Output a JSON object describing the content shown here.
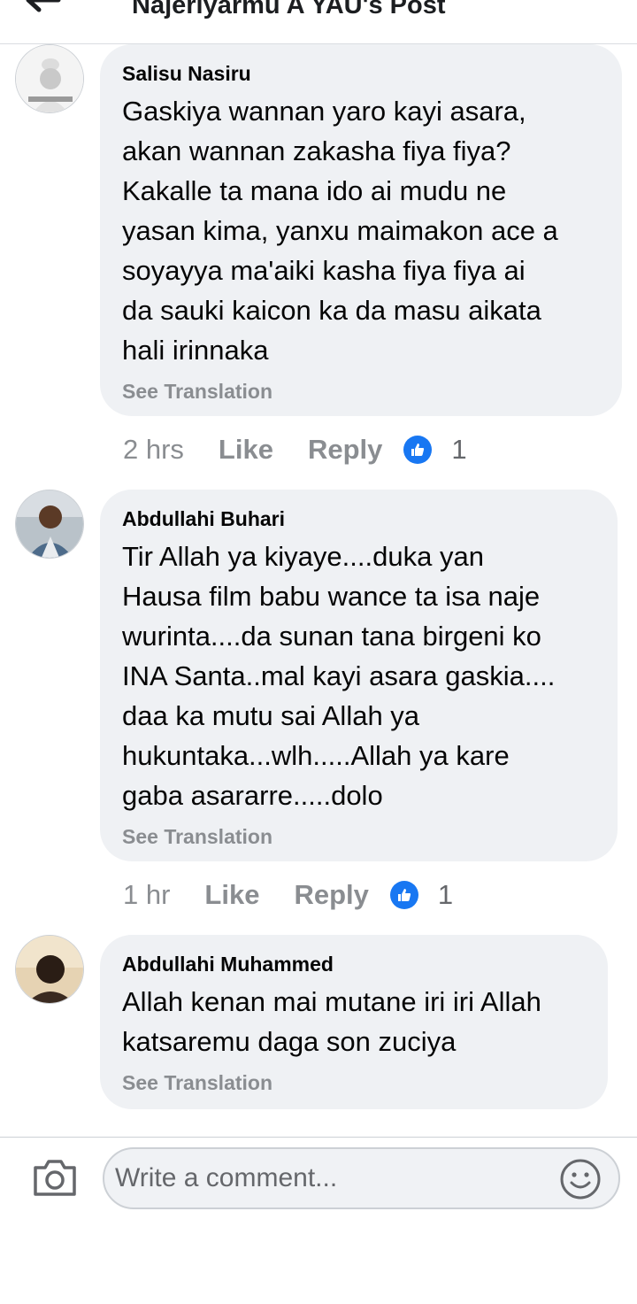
{
  "header": {
    "title": "Najeriyarmu A YAU's Post"
  },
  "comments": [
    {
      "author": "Salisu Nasiru",
      "text": "Gaskiya wannan yaro kayi asara,\nakan wannan zakasha fiya fiya?\nKakalle ta mana ido ai mudu ne\nyasan kima, yanxu maimakon ace a\nsoyayya ma'aiki kasha fiya fiya ai\nda sauki kaicon ka da masu aikata\nhali irinnaka",
      "translate": "See Translation",
      "time": "2 hrs",
      "like": "Like",
      "reply": "Reply",
      "reactions": "1"
    },
    {
      "author": "Abdullahi Buhari",
      "text": "Tir Allah ya kiyaye....duka yan\nHausa film babu wance ta isa naje\nwurinta....da sunan tana birgeni ko\nINA Santa..mal kayi asara gaskia....\ndaa ka mutu sai Allah ya\nhukuntaka...wlh.....Allah ya kare\ngaba asararre.....dolo",
      "translate": "See Translation",
      "time": "1 hr",
      "like": "Like",
      "reply": "Reply",
      "reactions": "1"
    },
    {
      "author": "Abdullahi Muhammed",
      "text": "Allah kenan mai mutane iri iri Allah\nkatsaremu daga son zuciya",
      "translate": "See Translation"
    }
  ],
  "footer": {
    "placeholder": "Write a comment...",
    "camera_icon": "camera-icon",
    "emoji_icon": "smiley-icon"
  },
  "colors": {
    "like_blue": "#1877f2",
    "bubble": "#eff1f4",
    "muted": "#8a8d91"
  }
}
